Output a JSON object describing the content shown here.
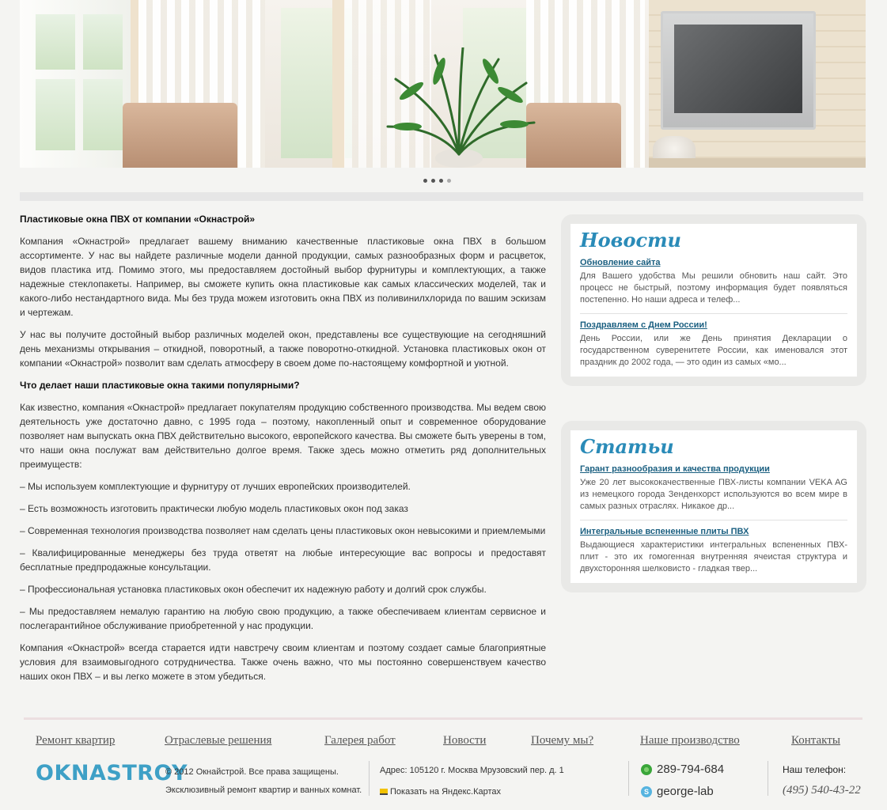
{
  "slider": {
    "active_index": 3,
    "count": 4
  },
  "content": {
    "title": "Пластиковые окна ПВХ от компании «Окнастрой»",
    "paragraphs_1": [
      "Компания «Окнастрой» предлагает вашему вниманию качественные пластиковые окна ПВХ в большом ассортименте. У нас вы найдете различные модели данной продукции, самых разнообразных форм и расцветок, видов пластика итд. Помимо этого, мы предоставляем достойный выбор фурнитуры и комплектующих, а также надежные стеклопакеты. Например, вы сможете купить окна пластиковые как самых классических моделей, так и какого-либо нестандартного вида. Мы без труда можем изготовить окна ПВХ из поливинилхлорида по вашим эскизам и чертежам.",
      "У нас вы получите достойный выбор различных моделей окон, представлены все существующие на сегодняшний день механизмы открывания – откидной, поворотный, а также поворотно-откидной. Установка пластиковых окон от компании «Окнастрой» позволит вам сделать атмосферу в своем доме по-настоящему комфортной и уютной."
    ],
    "subtitle": "Что делает наши пластиковые окна такими популярными?",
    "paragraphs_2": [
      "Как известно, компания «Окнастрой» предлагает покупателям продукцию собственного производства. Мы ведем свою деятельность уже достаточно давно, с 1995 года – поэтому, накопленный опыт и современное оборудование позволяет нам выпускать окна ПВХ действительно высокого, европейского качества. Вы сможете быть уверены в том, что наши окна послужат вам действительно долгое время. Также здесь можно отметить ряд дополнительных преимуществ:",
      "– Мы используем комплектующие и фурнитуру от лучших европейских производителей.",
      "– Есть возможность изготовить практически любую модель пластиковых окон под заказ",
      "– Современная технология производства позволяет нам сделать цены пластиковых окон невысокими и приемлемыми",
      "– Квалифицированные менеджеры без труда ответят на любые интересующие вас вопросы и предоставят бесплатные предпродажные консультации.",
      "– Профессиональная установка пластиковых окон обеспечит их надежную работу и долгий срок службы.",
      "– Мы предоставляем немалую гарантию на любую свою продукцию, а также обеспечиваем клиентам сервисное и послегарантийное обслуживание приобретенной у нас продукции.",
      "Компания «Окнастрой» всегда старается идти навстречу своим клиентам и поэтому создает самые благоприятные условия для взаимовыгодного сотрудничества. Также очень важно, что мы постоянно совершенствуем качество наших окон ПВХ – и вы легко можете в этом убедиться."
    ]
  },
  "news": {
    "title": "Новости",
    "items": [
      {
        "link": "Обновление сайта",
        "text": "Для Вашего удобства Мы решили обновить наш сайт. Это процесс не быстрый, поэтому информация будет появляться постепенно. Но наши адреса и телеф..."
      },
      {
        "link": "Поздравляем с Днем России!",
        "text": "День России, или же День принятия Декларации о государственном суверенитете России, как именовался этот праздник до 2002 года, — это один из самых «мо..."
      }
    ]
  },
  "articles": {
    "title": "Статьи",
    "items": [
      {
        "link": "Гарант разнообразия и качества продукции",
        "text": "Уже 20 лет высококачественные ПВХ-листы компании VEKA AG из немецкого города Зенденхорст используются во всем мире в самых разных отраслях. Никакое др..."
      },
      {
        "link": "Интегральные вспененные плиты ПВХ",
        "text": "Выдающиеся характеристики интегральных вспененных ПВХ-плит - это их гомогенная внутренняя ячеистая структура и двухсторонняя шелковисто - гладкая твер..."
      }
    ]
  },
  "footer": {
    "nav": [
      "Ремонт квартир",
      "Отраслевые решения",
      "Галерея работ",
      "Новости",
      "Почему мы?",
      "Наше производство",
      "Контакты"
    ],
    "logo": "OKNASTROY",
    "copyright": "© 2012 Окнайстрой. Все права защищены.",
    "tagline": "Эксклюзивный ремонт квартир и ванных комнат.",
    "address": "Адрес: 105120 г. Москва Мрузовский пер. д. 1",
    "map_link": "Показать на Яндекс.Картах",
    "phone_icq": "289-794-684",
    "skype": "george-lab",
    "phone_label": "Наш телефон:",
    "phone": "(495) 540-43-22",
    "icq_color": "#3aa63a",
    "skype_color": "#56b4e0"
  }
}
